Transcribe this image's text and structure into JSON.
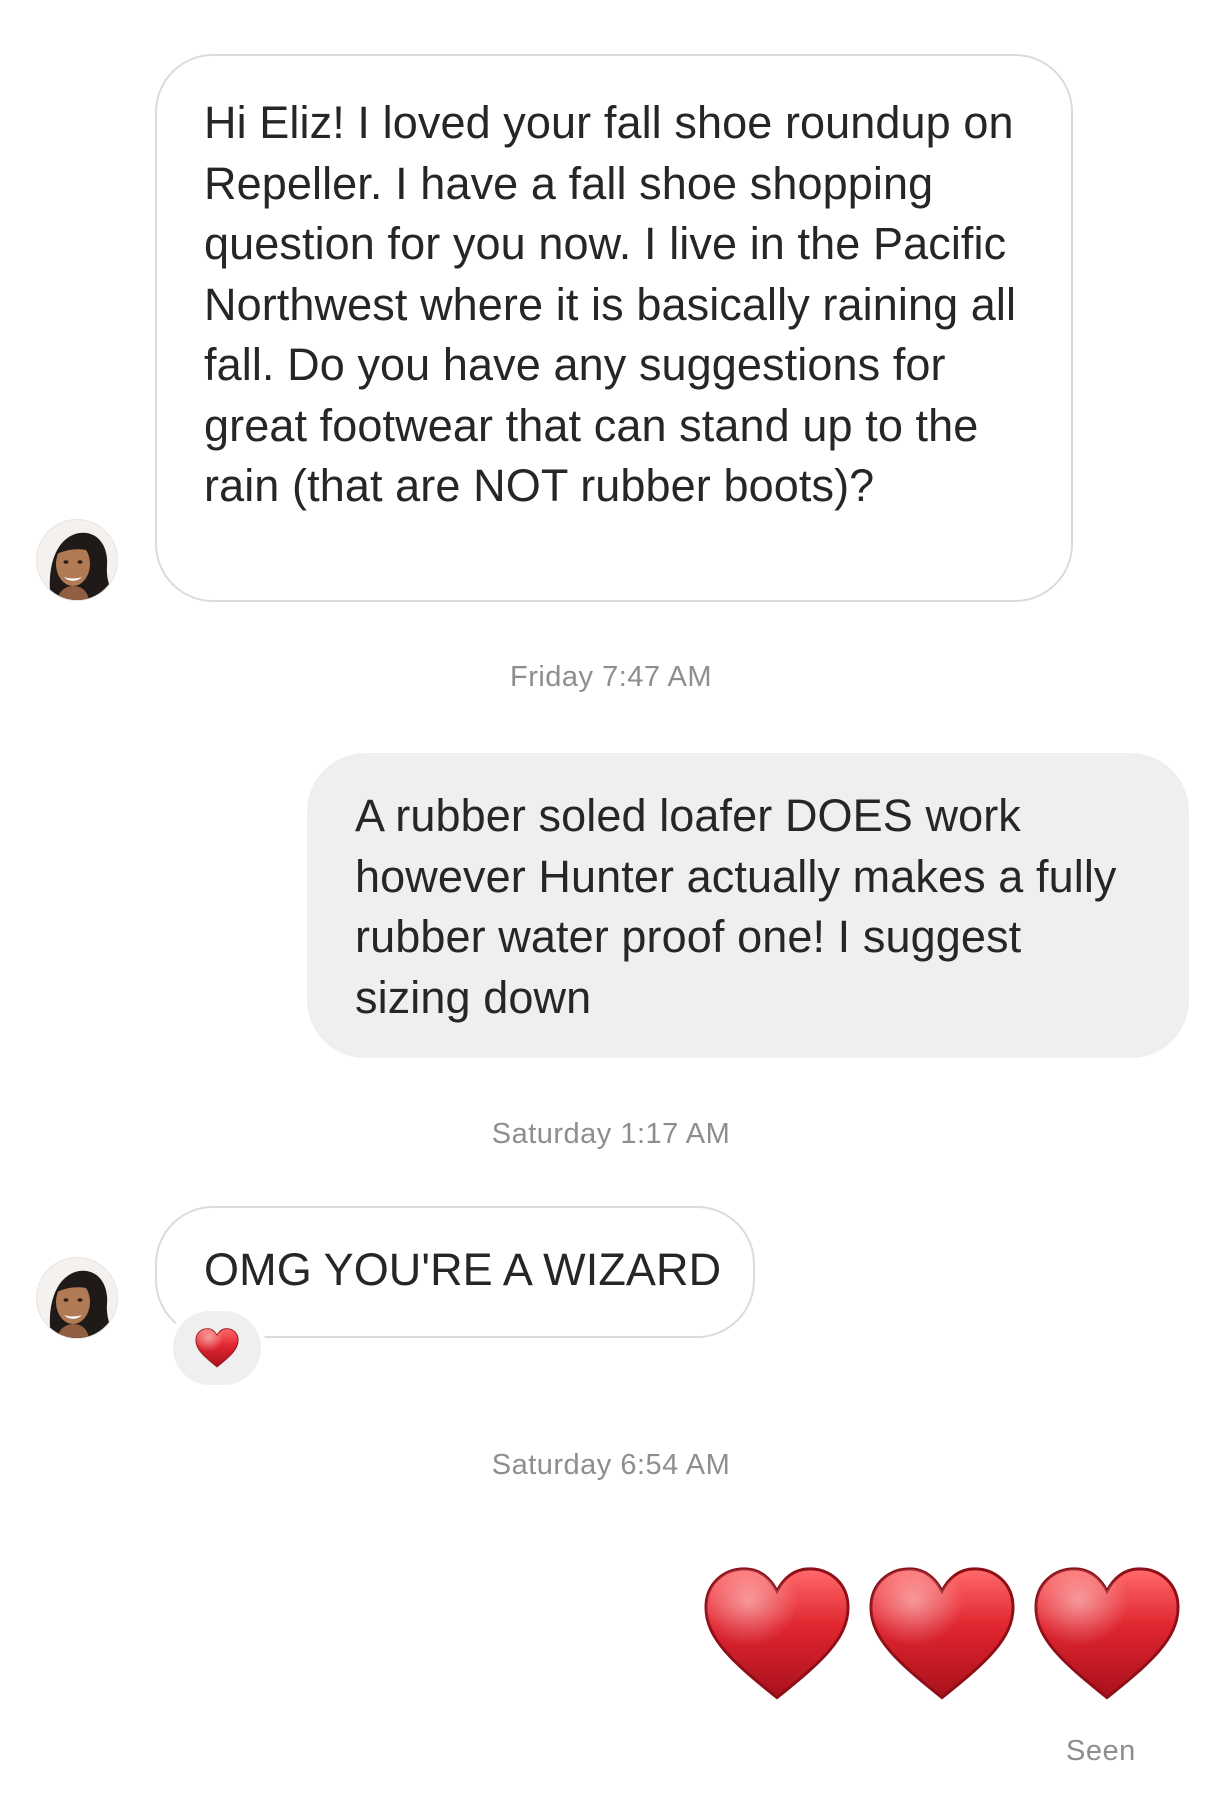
{
  "thread": {
    "messages": [
      {
        "sender": "incoming",
        "text": "Hi Eliz! I loved your fall shoe roundup on Repeller. I have a fall shoe shopping question for you now. I live in the Pacific Northwest where it is basically raining all fall. Do you have any suggestions for great footwear that can stand up to the rain (that are NOT rubber boots)?"
      },
      {
        "timestamp": "Friday 7:47 AM"
      },
      {
        "sender": "outgoing",
        "text": "A rubber soled loafer DOES work however Hunter actually makes a fully rubber water proof one! I suggest sizing down"
      },
      {
        "timestamp": "Saturday 1:17 AM"
      },
      {
        "sender": "incoming",
        "text": "OMG YOU'RE A WIZARD",
        "reaction": "red-heart-icon"
      },
      {
        "timestamp": "Saturday 6:54 AM"
      },
      {
        "sender": "outgoing",
        "emoji": [
          "red-heart-icon",
          "red-heart-icon",
          "red-heart-icon"
        ]
      }
    ],
    "status": "Seen"
  },
  "colors": {
    "outgoing_bubble": "#efefef",
    "incoming_border": "#dbdbdb",
    "muted_text": "#8e8e8e",
    "heart_red": "#d01d2a"
  }
}
